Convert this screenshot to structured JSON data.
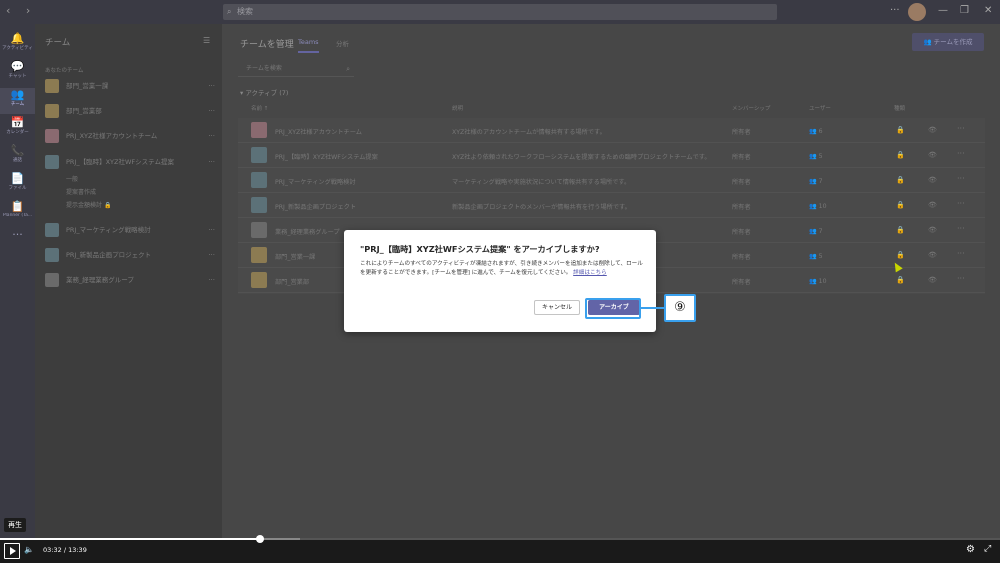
{
  "search": {
    "placeholder": "検索"
  },
  "rail": [
    {
      "icon": "bell-icon",
      "glyph": "🔔",
      "label": "アクティビティ"
    },
    {
      "icon": "chat-icon",
      "glyph": "💬",
      "label": "チャット"
    },
    {
      "icon": "teams-icon",
      "glyph": "👥",
      "label": "チーム"
    },
    {
      "icon": "calendar-icon",
      "glyph": "📅",
      "label": "カレンダー"
    },
    {
      "icon": "phone-icon",
      "glyph": "📞",
      "label": "通話"
    },
    {
      "icon": "file-icon",
      "glyph": "📄",
      "label": "ファイル"
    },
    {
      "icon": "planner-icon",
      "glyph": "📋",
      "label": "Planner (Ta..."
    },
    {
      "icon": "more-icon",
      "glyph": "···",
      "label": ""
    }
  ],
  "sidebar": {
    "header": "チーム",
    "section": "あなたのチーム",
    "teams": [
      {
        "name": "部門_営業一課",
        "logo": "crown"
      },
      {
        "name": "部門_営業部",
        "logo": "crown"
      },
      {
        "name": "PRJ_XYZ社様アカウントチーム",
        "logo": "pink"
      },
      {
        "name": "PRJ_【臨時】XYZ社WFシステム提案",
        "logo": "blue"
      },
      {
        "name": "PRJ_マーケティング戦略検討",
        "logo": "blue"
      },
      {
        "name": "PRJ_新製品企画プロジェクト",
        "logo": "blue"
      },
      {
        "name": "業務_経理業務グループ",
        "logo": "grey"
      }
    ],
    "channels": [
      "一般",
      "提案書作成",
      "提示金額検討"
    ],
    "channel_badge": "🔒"
  },
  "main": {
    "title": "チームを管理",
    "tabs": [
      "Teams",
      "分析"
    ],
    "create_button": "チームを作成",
    "team_search_placeholder": "チームを検索",
    "active_group": "アクティブ (7)",
    "columns": [
      "名前 ↑",
      "説明",
      "メンバーシップ",
      "ユーザー",
      "種類"
    ],
    "rows": [
      {
        "name": "PRJ_XYZ社様アカウントチーム",
        "desc": "XYZ社様のアカウントチームが情報共有する場所です。",
        "membership": "所有者",
        "users": "6",
        "logo": "pink"
      },
      {
        "name": "PRJ_【臨時】XYZ社WFシステム提案",
        "desc": "XYZ社より依頼されたワークフローシステムを提案するための臨時プロジェクトチームです。",
        "membership": "所有者",
        "users": "5",
        "logo": "blue"
      },
      {
        "name": "PRJ_マーケティング戦略検討",
        "desc": "マーケティング戦略や実施状況について情報共有する場所です。",
        "membership": "所有者",
        "users": "7",
        "logo": "blue"
      },
      {
        "name": "PRJ_新製品企画プロジェクト",
        "desc": "新製品企画プロジェクトのメンバーが情報共有を行う場所です。",
        "membership": "所有者",
        "users": "10",
        "logo": "blue"
      },
      {
        "name": "業務_経理業務グループ",
        "desc": "",
        "membership": "所有者",
        "users": "7",
        "logo": "grey"
      },
      {
        "name": "部門_営業一課",
        "desc": "",
        "membership": "所有者",
        "users": "5",
        "logo": "crown"
      },
      {
        "name": "部門_営業部",
        "desc": "",
        "membership": "所有者",
        "users": "10",
        "logo": "crown"
      }
    ]
  },
  "dialog": {
    "title": "\"PRJ_【臨時】XYZ社WFシステム提案\" をアーカイブしますか?",
    "body": "これによりチームのすべてのアクティビティが凍結されますが、引き続きメンバーを追加または削除して、ロールを更新することができます。[チームを管理] に進んで、チームを復元してください。",
    "link": "詳細はこちら",
    "cancel": "キャンセル",
    "confirm": "アーカイブ",
    "step_badge": "⑨"
  },
  "video": {
    "tooltip": "再生",
    "current": "03:32",
    "separator": "/",
    "total": "13:39",
    "progress": 0.26,
    "buffered": 0.3
  },
  "colors": {
    "accent": "#6264a7",
    "highlight": "#39a0ed"
  }
}
